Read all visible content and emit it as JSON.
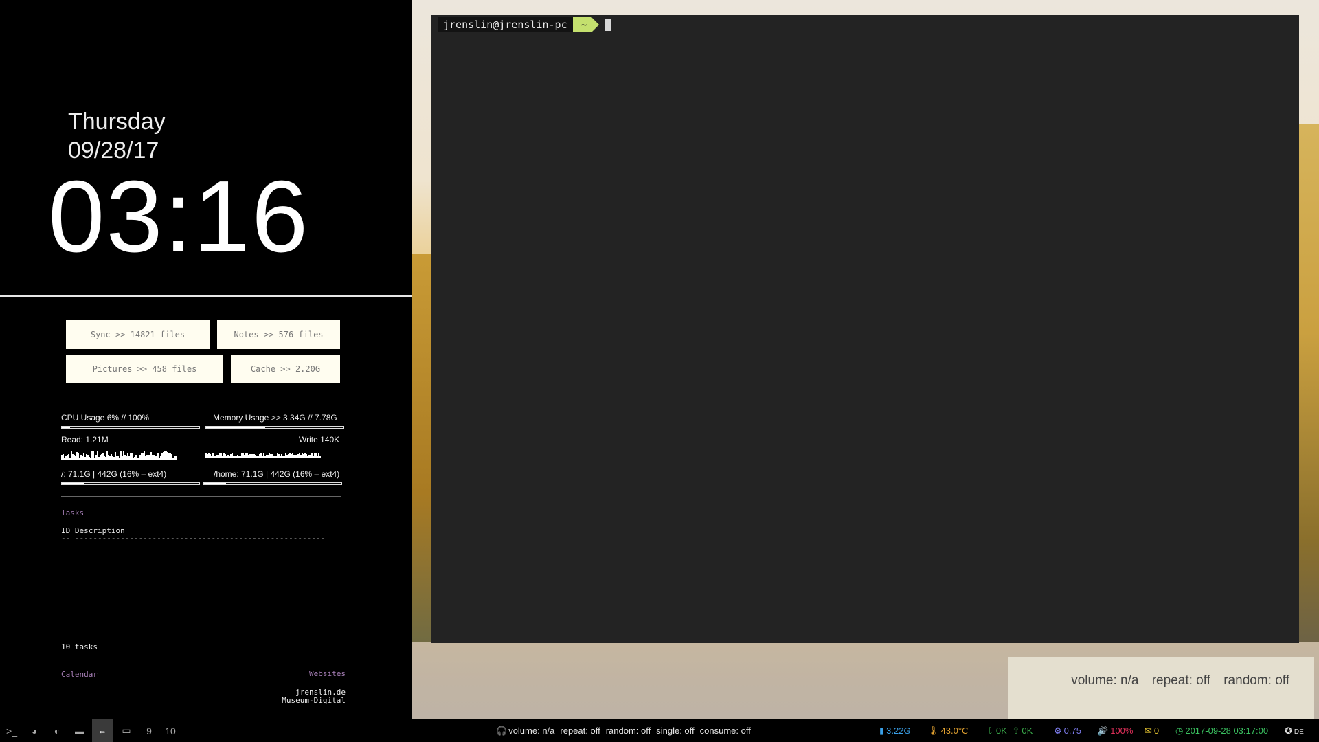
{
  "clock": {
    "day": "Thursday",
    "date": "09/28/17",
    "time": "03:16"
  },
  "stat_boxes": [
    {
      "label": "Sync >> 14821 files"
    },
    {
      "label": "Notes >> 576 files"
    },
    {
      "label": "Pictures >> 458 files"
    },
    {
      "label": "Cache >> 2.20G"
    }
  ],
  "system": {
    "cpu_label": "CPU Usage 6% // 100%",
    "cpu_usage": 0.06,
    "mem_label": "Memory Usage >> 3.34G // 7.78G",
    "mem_usage": 0.43,
    "read_label": "Read: 1.21M",
    "write_label": "Write 140K",
    "root_label": "/: 71.1G | 442G (16% – ext4)",
    "root_usage": 0.16,
    "home_label": "/home: 71.1G | 442G (16% – ext4)",
    "home_usage": 0.16
  },
  "tasks": {
    "heading": "Tasks",
    "columns": "ID Description",
    "underline": "-- -------------------------------------------------------",
    "count": "10 tasks"
  },
  "links": {
    "calendar": "Calendar",
    "websites": "Websites",
    "site1": "jrenslin.de",
    "site2": "Museum-Digital"
  },
  "terminal": {
    "user_host": "jrenslin@jrenslin-pc",
    "cwd": "~"
  },
  "mpd_popup": {
    "volume": "volume: n/a",
    "repeat": "repeat: off",
    "random": "random: off"
  },
  "workspaces": [
    {
      "label": ">_",
      "icon": "terminal-icon"
    },
    {
      "label": "◕",
      "icon": "globe-icon"
    },
    {
      "label": "◐",
      "icon": "contrast-icon"
    },
    {
      "label": "▬",
      "icon": "folder-icon"
    },
    {
      "label": "⇔",
      "icon": "link-icon",
      "active": true
    },
    {
      "label": "▭",
      "icon": "book-icon"
    },
    {
      "label": "9"
    },
    {
      "label": "10"
    }
  ],
  "bar_mpd": {
    "volume": "volume: n/a",
    "repeat": "repeat: off",
    "random": "random: off",
    "single": "single: off",
    "consume": "consume: off"
  },
  "tray": {
    "memory": "3.22G",
    "temperature": "43.0°C",
    "net_down": "0K",
    "net_up": "0K",
    "load": "0.75",
    "volume": "100%",
    "mail": "0",
    "datetime": "2017-09-28 03:17:00",
    "layout": "DE"
  },
  "colors": {
    "memory": "#3aa0e8",
    "temperature": "#e0a030",
    "network": "#3aa84a",
    "load": "#7a7ae8",
    "volume": "#e0305a",
    "mail": "#e0c030",
    "datetime": "#3ac060"
  }
}
